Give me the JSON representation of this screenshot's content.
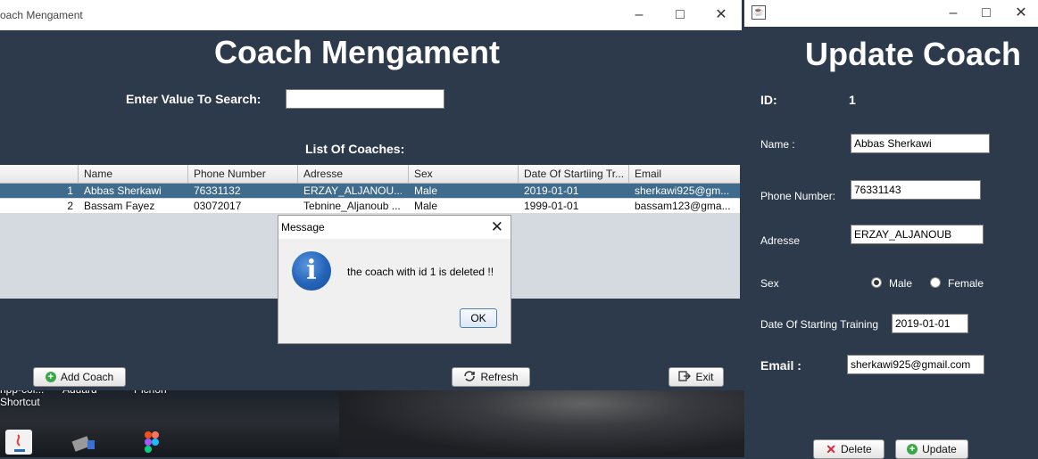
{
  "main_window": {
    "title": "oach Mengament",
    "heading": "Coach Mengament",
    "search_label": "Enter Value To Search:",
    "search_value": "",
    "list_label": "List Of Coaches:",
    "columns": [
      "",
      "Name",
      "Phone Number",
      "Adresse",
      "Sex",
      "Date Of Startiing Tr...",
      "Email"
    ],
    "rows": [
      {
        "id": "1",
        "name": "Abbas Sherkawi",
        "phone": "76331132",
        "adresse": "ERZAY_ALJANOU...",
        "sex": "Male",
        "date": "2019-01-01",
        "email": "sherkawi925@gm...",
        "selected": true
      },
      {
        "id": "2",
        "name": "Bassam Fayez",
        "phone": "03072017",
        "adresse": "Tebnine_Aljanoub ...",
        "sex": "Male",
        "date": "1999-01-01",
        "email": "bassam123@gma...",
        "selected": false
      }
    ],
    "buttons": {
      "add": "Add Coach",
      "refresh": "Refresh",
      "exit": "Exit"
    }
  },
  "dialog": {
    "title": "Message",
    "message": "the coach with id 1 is deleted !!",
    "ok": "OK",
    "icon": "info-icon"
  },
  "update_window": {
    "heading": "Update Coach",
    "id_label": "ID:",
    "id_value": "1",
    "name_label": "Name :",
    "name_value": "Abbas Sherkawi",
    "phone_label": "Phone Number:",
    "phone_value": "76331143",
    "adresse_label": "Adresse",
    "adresse_value": "ERZAY_ALJANOUB",
    "sex_label": "Sex",
    "male_label": "Male",
    "female_label": "Female",
    "selected_sex": "Male",
    "date_label": "Date Of Starting Training",
    "date_value": "2019-01-01",
    "email_label": "Email :",
    "email_value": "sherkawi925@gmail.com",
    "delete_button": "Delete",
    "update_button": "Update"
  },
  "desktop": {
    "labels": [
      "npp-col...",
      "Aduard",
      "Pichon",
      "Shortcut"
    ]
  },
  "colors": {
    "window_bg": "#2d3a4b",
    "selected_row": "#3f6b8c",
    "accent_blue": "#2463b7"
  }
}
